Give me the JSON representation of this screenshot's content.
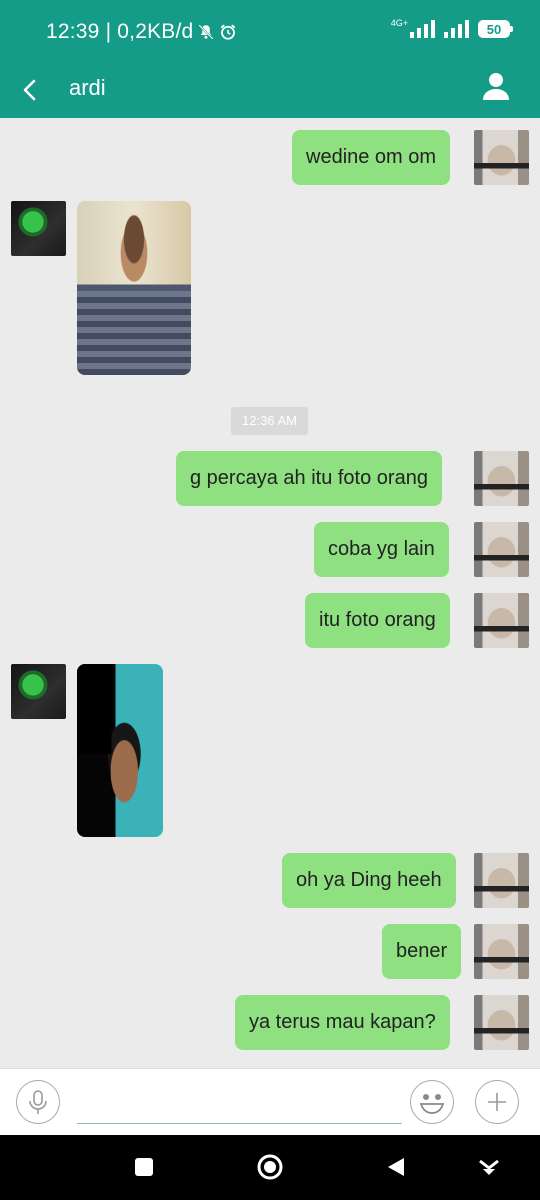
{
  "status_bar": {
    "time": "12:39",
    "network_speed": "0,2KB/d",
    "network_type": "4G+",
    "battery": "50"
  },
  "header": {
    "contact_name": "ardi",
    "back_icon": "back-arrow-icon",
    "profile_icon": "person-icon"
  },
  "messages": [
    {
      "text": "wedine om om"
    },
    {
      "text": "g percaya ah itu foto orang"
    },
    {
      "text": "coba yg lain"
    },
    {
      "text": "itu foto orang"
    },
    {
      "text": "oh ya Ding heeh"
    },
    {
      "text": "bener"
    },
    {
      "text": "ya terus mau kapan?"
    }
  ],
  "timestamp": "12:36 AM",
  "input": {
    "placeholder": "",
    "value": ""
  },
  "colors": {
    "header_bg": "#149c88",
    "bubble_sent": "#8ee081",
    "chat_bg": "#ebebeb"
  }
}
